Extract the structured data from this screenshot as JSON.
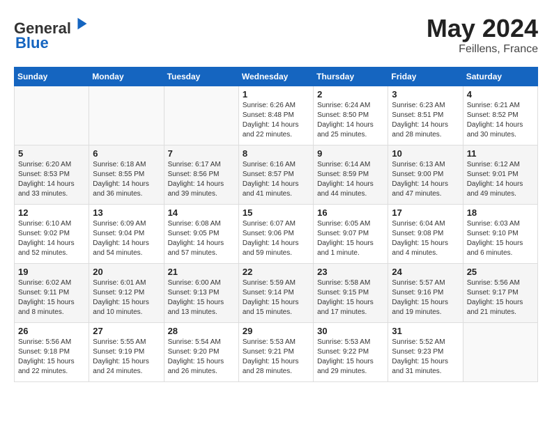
{
  "header": {
    "logo_line1": "General",
    "logo_line2": "Blue",
    "title": "May 2024",
    "location": "Feillens, France"
  },
  "days_of_week": [
    "Sunday",
    "Monday",
    "Tuesday",
    "Wednesday",
    "Thursday",
    "Friday",
    "Saturday"
  ],
  "weeks": [
    [
      {
        "day": "",
        "info": ""
      },
      {
        "day": "",
        "info": ""
      },
      {
        "day": "",
        "info": ""
      },
      {
        "day": "1",
        "info": "Sunrise: 6:26 AM\nSunset: 8:48 PM\nDaylight: 14 hours\nand 22 minutes."
      },
      {
        "day": "2",
        "info": "Sunrise: 6:24 AM\nSunset: 8:50 PM\nDaylight: 14 hours\nand 25 minutes."
      },
      {
        "day": "3",
        "info": "Sunrise: 6:23 AM\nSunset: 8:51 PM\nDaylight: 14 hours\nand 28 minutes."
      },
      {
        "day": "4",
        "info": "Sunrise: 6:21 AM\nSunset: 8:52 PM\nDaylight: 14 hours\nand 30 minutes."
      }
    ],
    [
      {
        "day": "5",
        "info": "Sunrise: 6:20 AM\nSunset: 8:53 PM\nDaylight: 14 hours\nand 33 minutes."
      },
      {
        "day": "6",
        "info": "Sunrise: 6:18 AM\nSunset: 8:55 PM\nDaylight: 14 hours\nand 36 minutes."
      },
      {
        "day": "7",
        "info": "Sunrise: 6:17 AM\nSunset: 8:56 PM\nDaylight: 14 hours\nand 39 minutes."
      },
      {
        "day": "8",
        "info": "Sunrise: 6:16 AM\nSunset: 8:57 PM\nDaylight: 14 hours\nand 41 minutes."
      },
      {
        "day": "9",
        "info": "Sunrise: 6:14 AM\nSunset: 8:59 PM\nDaylight: 14 hours\nand 44 minutes."
      },
      {
        "day": "10",
        "info": "Sunrise: 6:13 AM\nSunset: 9:00 PM\nDaylight: 14 hours\nand 47 minutes."
      },
      {
        "day": "11",
        "info": "Sunrise: 6:12 AM\nSunset: 9:01 PM\nDaylight: 14 hours\nand 49 minutes."
      }
    ],
    [
      {
        "day": "12",
        "info": "Sunrise: 6:10 AM\nSunset: 9:02 PM\nDaylight: 14 hours\nand 52 minutes."
      },
      {
        "day": "13",
        "info": "Sunrise: 6:09 AM\nSunset: 9:04 PM\nDaylight: 14 hours\nand 54 minutes."
      },
      {
        "day": "14",
        "info": "Sunrise: 6:08 AM\nSunset: 9:05 PM\nDaylight: 14 hours\nand 57 minutes."
      },
      {
        "day": "15",
        "info": "Sunrise: 6:07 AM\nSunset: 9:06 PM\nDaylight: 14 hours\nand 59 minutes."
      },
      {
        "day": "16",
        "info": "Sunrise: 6:05 AM\nSunset: 9:07 PM\nDaylight: 15 hours\nand 1 minute."
      },
      {
        "day": "17",
        "info": "Sunrise: 6:04 AM\nSunset: 9:08 PM\nDaylight: 15 hours\nand 4 minutes."
      },
      {
        "day": "18",
        "info": "Sunrise: 6:03 AM\nSunset: 9:10 PM\nDaylight: 15 hours\nand 6 minutes."
      }
    ],
    [
      {
        "day": "19",
        "info": "Sunrise: 6:02 AM\nSunset: 9:11 PM\nDaylight: 15 hours\nand 8 minutes."
      },
      {
        "day": "20",
        "info": "Sunrise: 6:01 AM\nSunset: 9:12 PM\nDaylight: 15 hours\nand 10 minutes."
      },
      {
        "day": "21",
        "info": "Sunrise: 6:00 AM\nSunset: 9:13 PM\nDaylight: 15 hours\nand 13 minutes."
      },
      {
        "day": "22",
        "info": "Sunrise: 5:59 AM\nSunset: 9:14 PM\nDaylight: 15 hours\nand 15 minutes."
      },
      {
        "day": "23",
        "info": "Sunrise: 5:58 AM\nSunset: 9:15 PM\nDaylight: 15 hours\nand 17 minutes."
      },
      {
        "day": "24",
        "info": "Sunrise: 5:57 AM\nSunset: 9:16 PM\nDaylight: 15 hours\nand 19 minutes."
      },
      {
        "day": "25",
        "info": "Sunrise: 5:56 AM\nSunset: 9:17 PM\nDaylight: 15 hours\nand 21 minutes."
      }
    ],
    [
      {
        "day": "26",
        "info": "Sunrise: 5:56 AM\nSunset: 9:18 PM\nDaylight: 15 hours\nand 22 minutes."
      },
      {
        "day": "27",
        "info": "Sunrise: 5:55 AM\nSunset: 9:19 PM\nDaylight: 15 hours\nand 24 minutes."
      },
      {
        "day": "28",
        "info": "Sunrise: 5:54 AM\nSunset: 9:20 PM\nDaylight: 15 hours\nand 26 minutes."
      },
      {
        "day": "29",
        "info": "Sunrise: 5:53 AM\nSunset: 9:21 PM\nDaylight: 15 hours\nand 28 minutes."
      },
      {
        "day": "30",
        "info": "Sunrise: 5:53 AM\nSunset: 9:22 PM\nDaylight: 15 hours\nand 29 minutes."
      },
      {
        "day": "31",
        "info": "Sunrise: 5:52 AM\nSunset: 9:23 PM\nDaylight: 15 hours\nand 31 minutes."
      },
      {
        "day": "",
        "info": ""
      }
    ]
  ]
}
